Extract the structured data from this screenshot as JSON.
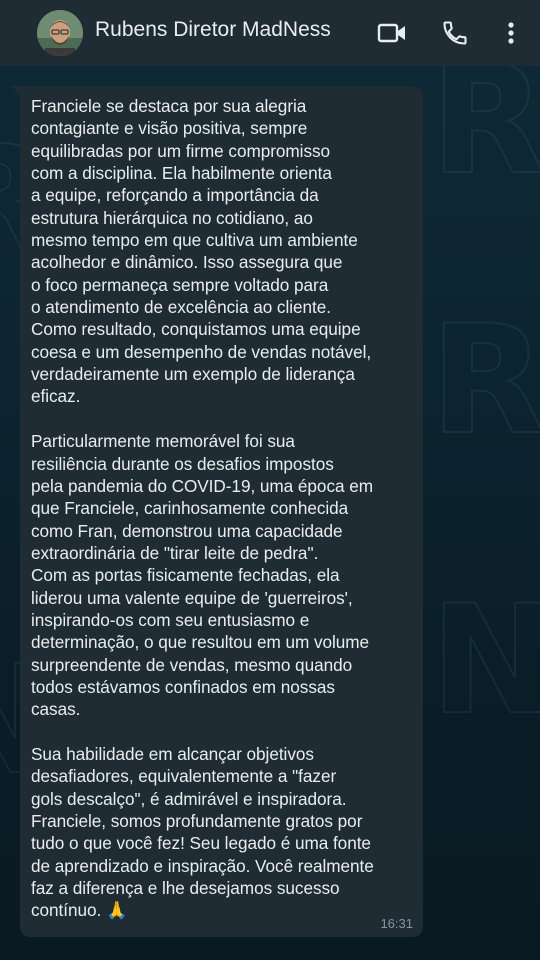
{
  "header": {
    "contact_name": "Rubens Diretor MadNess",
    "icons": {
      "video_call": "video-camera-icon",
      "voice_call": "phone-icon",
      "menu": "kebab-menu-icon"
    }
  },
  "message": {
    "text": "Franciele se destaca por sua alegria\ncontagiante e visão positiva, sempre\nequilibradas por um firme compromisso\ncom a disciplina. Ela habilmente orienta\na equipe, reforçando a importância da\nestrutura hierárquica no cotidiano, ao\nmesmo tempo em que cultiva um ambiente\nacolhedor e dinâmico. Isso assegura que\no foco permaneça sempre voltado para\no atendimento de excelência ao cliente.\nComo resultado, conquistamos uma equipe\ncoesa e um desempenho de vendas notável,\nverdadeiramente um exemplo de liderança\neficaz.\n\nParticularmente memorável foi sua\nresiliência durante os desafios impostos\npela pandemia do COVID-19, uma época em\nque Franciele, carinhosamente conhecida\ncomo Fran, demonstrou uma capacidade\nextraordinária de \"tirar leite de pedra\".\nCom as portas fisicamente fechadas, ela\nliderou uma valente equipe de 'guerreiros',\ninspirando-os com seu entusiasmo e\ndeterminação, o que resultou em um volume\nsurpreendente de vendas, mesmo quando\ntodos estávamos confinados em nossas\ncasas.\n\nSua habilidade em alcançar objetivos\ndesafiadores, equivalentemente a \"fazer\ngols descalço\", é admirável e inspiradora.\nFranciele, somos profundamente gratos por\ntudo o que você fez! Seu legado é uma fonte\nde aprendizado e inspiração. Você realmente\nfaz a diferença e lhe desejamos sucesso\ncontínuo. 🙏",
    "time": "16:31"
  },
  "colors": {
    "header_bg": "#1f2c33",
    "bubble_bg": "#1f2c33",
    "text": "#e9edef",
    "meta_text": "#8696a0",
    "wallpaper": "#0c2430"
  }
}
